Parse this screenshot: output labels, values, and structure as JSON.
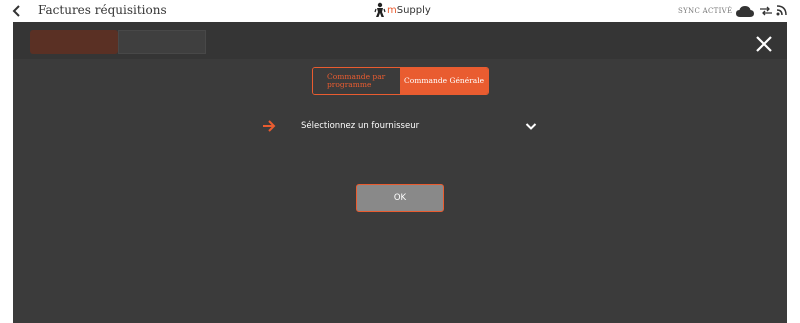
{
  "header": {
    "title": "Factures réquisitions",
    "logo_text_m": "m",
    "logo_text_rest": "Supply",
    "sync_status": "SYNC ACTIVÉ"
  },
  "modal": {
    "tabs": [
      {
        "label": "Commande par programme",
        "selected": false
      },
      {
        "label": "Commande Générale",
        "selected": true
      }
    ],
    "supplier_placeholder": "Sélectionnez un fournisseur",
    "ok_label": "OK"
  },
  "colors": {
    "accent": "#e95c30",
    "modal_bg": "#3b3b3b",
    "ok_bg": "#898989"
  },
  "icons": [
    "back-arrow-icon",
    "msupply-logo-icon",
    "cloud-icon",
    "sync-arrows-icon",
    "wifi-icon",
    "close-icon",
    "right-arrow-icon",
    "chevron-down-icon"
  ]
}
